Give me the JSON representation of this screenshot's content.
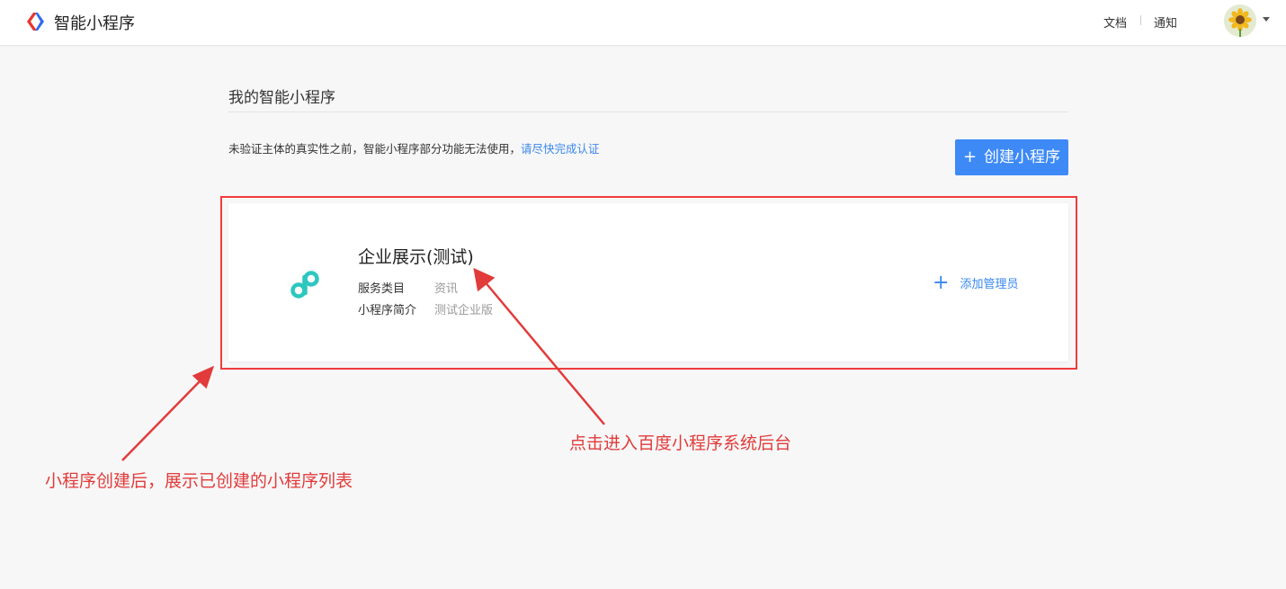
{
  "header": {
    "brand": "智能小程序",
    "nav": {
      "docs": "文档",
      "notifications": "通知"
    },
    "colors": {
      "logo_red": "#e8382f",
      "logo_blue": "#2f6cf0"
    }
  },
  "main": {
    "page_title": "我的智能小程序",
    "notice_text": "未验证主体的真实性之前，智能小程序部分功能无法使用，",
    "notice_link": "请尽快完成认证",
    "create_button": {
      "icon": "+",
      "label": "创建小程序"
    }
  },
  "app_card": {
    "name": "企业展示(测试)",
    "icon": "smart-program-icon",
    "fields": [
      {
        "label": "服务类目",
        "value": "资讯"
      },
      {
        "label": "小程序简介",
        "value": "测试企业版"
      }
    ],
    "add_admin_label": "添加管理员"
  },
  "annotations": {
    "enter_backend": "点击进入百度小程序系统后台",
    "list_note": "小程序创建后，展示已创建的小程序列表",
    "color": "#e23b3b"
  },
  "colors": {
    "accent": "#3d8af7",
    "link": "#3a87f0",
    "app_icon": "#2dc7c0",
    "highlight": "#f03c3c"
  }
}
